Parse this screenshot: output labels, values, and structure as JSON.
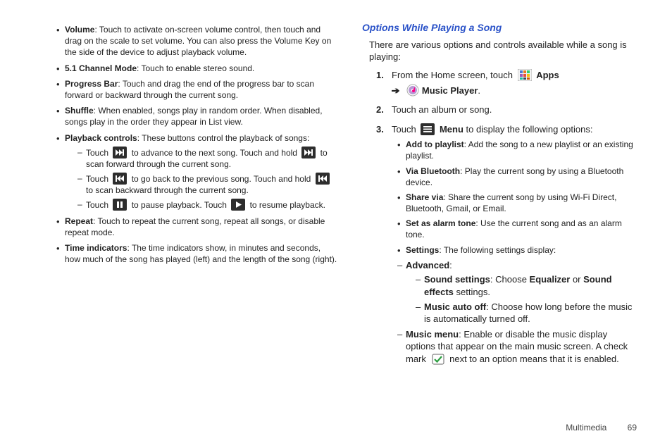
{
  "left_column": {
    "items": {
      "volume": {
        "label": "Volume",
        "text": ": Touch to activate on-screen volume control, then touch and drag on the scale to set volume. You can also press the Volume Key on the side of the device to adjust playback volume."
      },
      "channel": {
        "label": "5.1 Channel Mode",
        "text": ": Touch to enable stereo sound."
      },
      "progress": {
        "label": "Progress Bar",
        "text": ": Touch and drag the end of the progress bar to scan forward or backward through the current song."
      },
      "shuffle": {
        "label": "Shuffle",
        "text": ": When enabled, songs play in random order. When disabled, songs play in the order they appear in List view."
      },
      "playback": {
        "label": "Playback controls",
        "text": ": These buttons control the playback of songs:",
        "sub": {
          "next": {
            "pre": "Touch ",
            "mid": " to advance to the next song. Touch and hold ",
            "post": " to scan forward through the current song."
          },
          "prev": {
            "pre": "Touch ",
            "mid": " to go back to the previous song. Touch and hold ",
            "post": " to scan backward through the current song."
          },
          "pause": {
            "pre": "Touch ",
            "mid": " to pause playback. Touch ",
            "post": " to resume playback."
          }
        }
      },
      "repeat": {
        "label": "Repeat",
        "text": ": Touch to repeat the current song, repeat all songs, or disable repeat mode."
      },
      "time": {
        "label": "Time indicators",
        "text": ": The time indicators show, in minutes and seconds, how much of the song has played (left) and the length of the song (right)."
      }
    }
  },
  "right_column": {
    "heading": "Options While Playing a Song",
    "intro": "There are various options and controls available while a song is playing:",
    "step1": {
      "pre": "From the Home screen, touch ",
      "apps": "Apps",
      "arrow": "➔",
      "music_player": "Music Player",
      "period": "."
    },
    "step2": "Touch an album or song.",
    "step3": {
      "pre": "Touch ",
      "menu": "Menu",
      "post": " to display the following options:"
    },
    "options": {
      "add": {
        "label": "Add to playlist",
        "text": ": Add the song to a new playlist or an existing playlist."
      },
      "bt": {
        "label": "Via Bluetooth",
        "text": ": Play the current song by using a Bluetooth device."
      },
      "share": {
        "label": "Share via",
        "text": ": Share the current song by using Wi-Fi Direct, Bluetooth, Gmail, or Email."
      },
      "alarm": {
        "label": "Set as alarm tone",
        "text": ": Use the current song and as an alarm tone."
      },
      "settings": {
        "label": "Settings",
        "text": ": The following settings display:"
      }
    },
    "advanced": {
      "label": "Advanced",
      "colon": ":",
      "sound": {
        "label": "Sound settings",
        "pre": ": Choose ",
        "eq": "Equalizer",
        "or": " or ",
        "se": "Sound effects",
        "post": " settings."
      },
      "auto_off": {
        "label": "Music auto off",
        "text": ": Choose how long before the music is automatically turned off."
      }
    },
    "music_menu": {
      "label": "Music menu",
      "pre": ": Enable or disable the music display options that appear on the main music screen. A check mark ",
      "post": " next to an option means that it is enabled."
    }
  },
  "footer": {
    "section": "Multimedia",
    "page": "69"
  }
}
